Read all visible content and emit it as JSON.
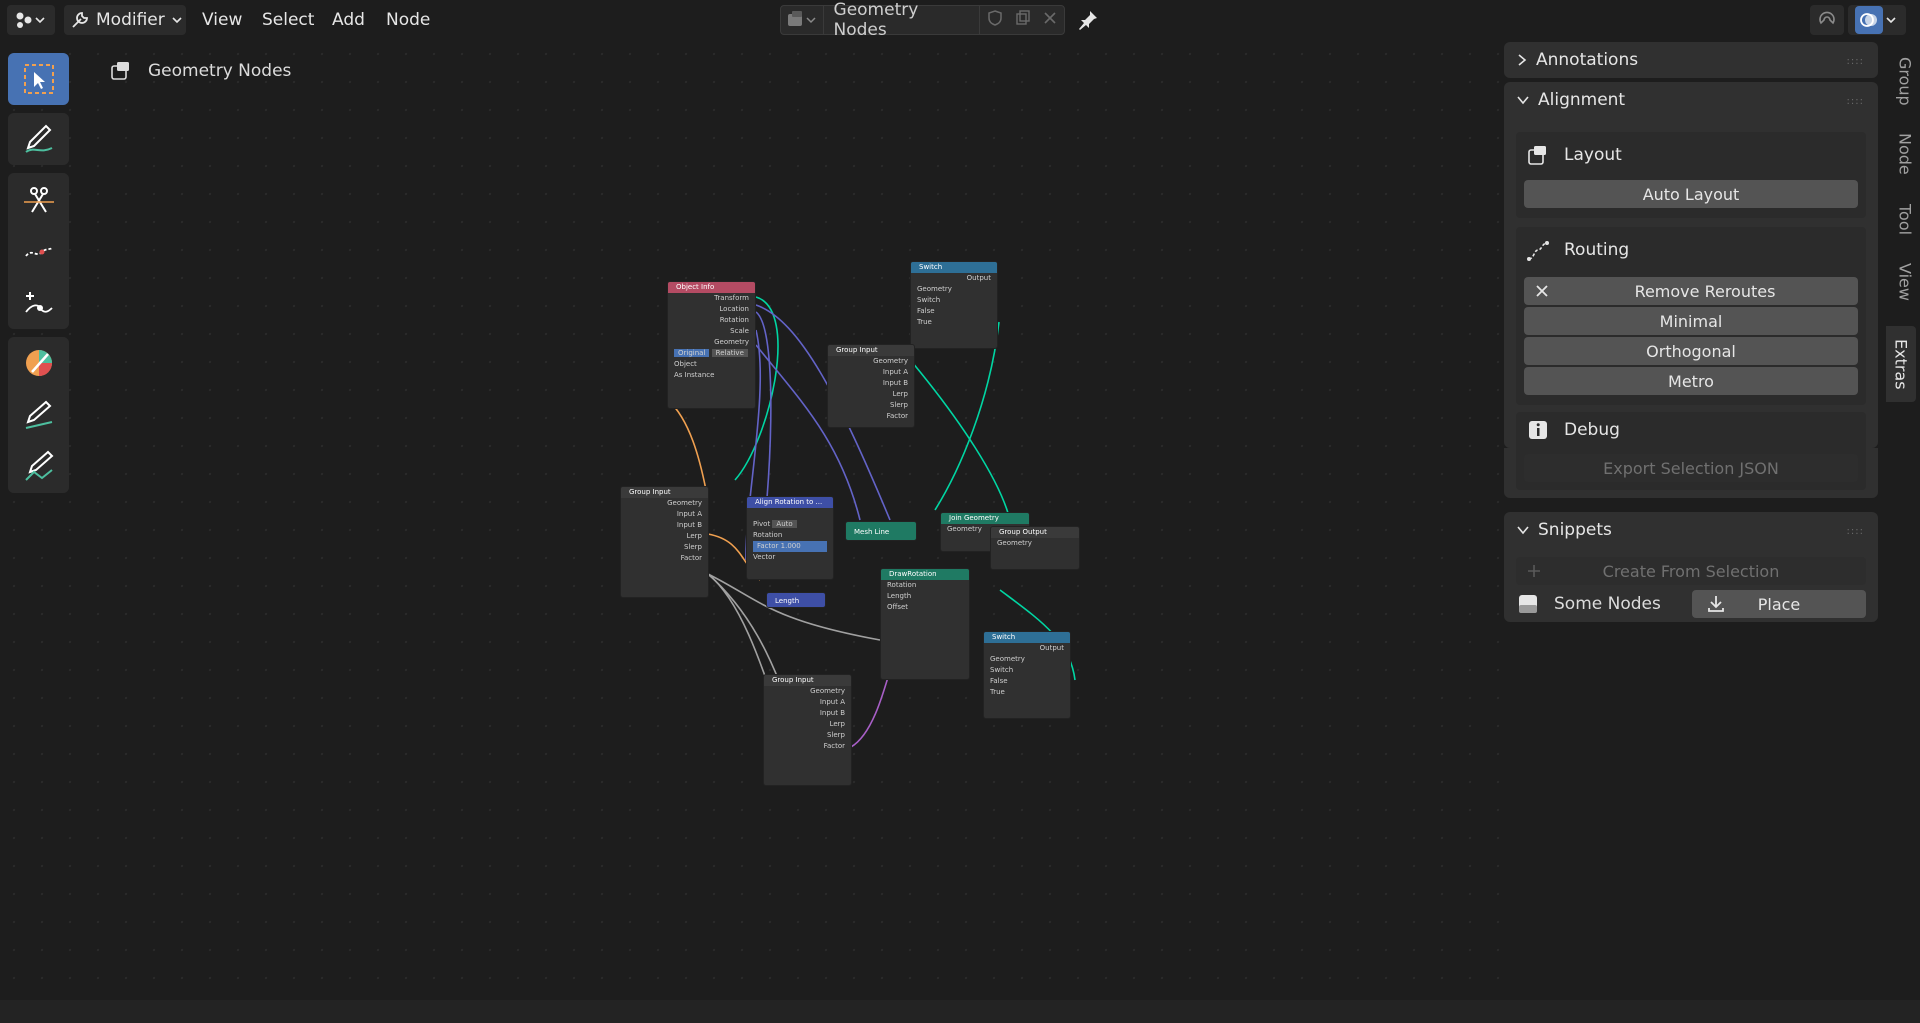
{
  "header": {
    "editor_mode": "Modifier",
    "menus": [
      "View",
      "Select",
      "Add",
      "Node"
    ],
    "node_tree_name": "Geometry Nodes"
  },
  "breadcrumb": {
    "label": "Geometry Nodes"
  },
  "sidebar": {
    "tabs": [
      "Group",
      "Node",
      "Tool",
      "View",
      "Extras"
    ],
    "active_tab": "Extras",
    "annotations": {
      "title": "Annotations"
    },
    "alignment": {
      "title": "Alignment",
      "layout": {
        "title": "Layout",
        "auto_layout": "Auto Layout"
      },
      "routing": {
        "title": "Routing",
        "remove_reroutes": "Remove Reroutes",
        "minimal": "Minimal",
        "orthogonal": "Orthogonal",
        "metro": "Metro"
      },
      "debug": {
        "title": "Debug",
        "export": "Export Selection JSON"
      }
    },
    "snippets": {
      "title": "Snippets",
      "create": "Create From Selection",
      "item_name": "Some Nodes",
      "place": "Place"
    }
  },
  "nodes": {
    "object_info": {
      "title": "Object Info",
      "rows": [
        "Transform",
        "Location",
        "Rotation",
        "Scale",
        "Geometry"
      ],
      "toggle_a": "Original",
      "toggle_b": "Relative",
      "object": "Object",
      "as_instance": "As Instance"
    },
    "switch_top": {
      "title": "Switch",
      "output": "Output",
      "type": "Geometry",
      "rows": [
        "Switch",
        "False",
        "True"
      ]
    },
    "group_input_mid": {
      "title": "Group Input",
      "rows": [
        "Geometry",
        "Input A",
        "Input B",
        "Lerp",
        "Slerp",
        "Factor"
      ]
    },
    "group_input_left": {
      "title": "Group Input",
      "rows": [
        "Geometry",
        "Input A",
        "Input B",
        "Lerp",
        "Slerp",
        "Factor"
      ]
    },
    "group_input_bottom": {
      "title": "Group Input",
      "rows": [
        "Geometry",
        "Input A",
        "Input B",
        "Lerp",
        "Slerp",
        "Factor"
      ]
    },
    "align_rotation": {
      "title": "Align Rotation to ...",
      "pivot": "Pivot",
      "auto": "Auto",
      "rotation": "Rotation",
      "factor": "Factor",
      "factor_value": "1.000",
      "vector": "Vector"
    },
    "mesh_line": {
      "title": "Mesh Line"
    },
    "join_geometry": {
      "title": "Join Geometry",
      "geometry": "Geometry"
    },
    "group_output": {
      "title": "Group Output",
      "geometry": "Geometry"
    },
    "draw_rotation": {
      "title": "DrawRotation",
      "rows": [
        "Rotation",
        "Length",
        "Offset"
      ]
    },
    "length": {
      "title": "Length"
    },
    "switch_bottom": {
      "title": "Switch",
      "output": "Output",
      "type": "Geometry",
      "rows": [
        "Switch",
        "False",
        "True"
      ]
    }
  },
  "colors": {
    "accent": "#4772b3",
    "socket_geometry": "#00d6a3",
    "socket_vector": "#6363c7",
    "socket_float": "#a1a1a1",
    "header_object_info": "#b44b63",
    "header_switch": "#2e6f96",
    "header_vector": "#3e4fa6",
    "header_geometry": "#1f7a63"
  }
}
